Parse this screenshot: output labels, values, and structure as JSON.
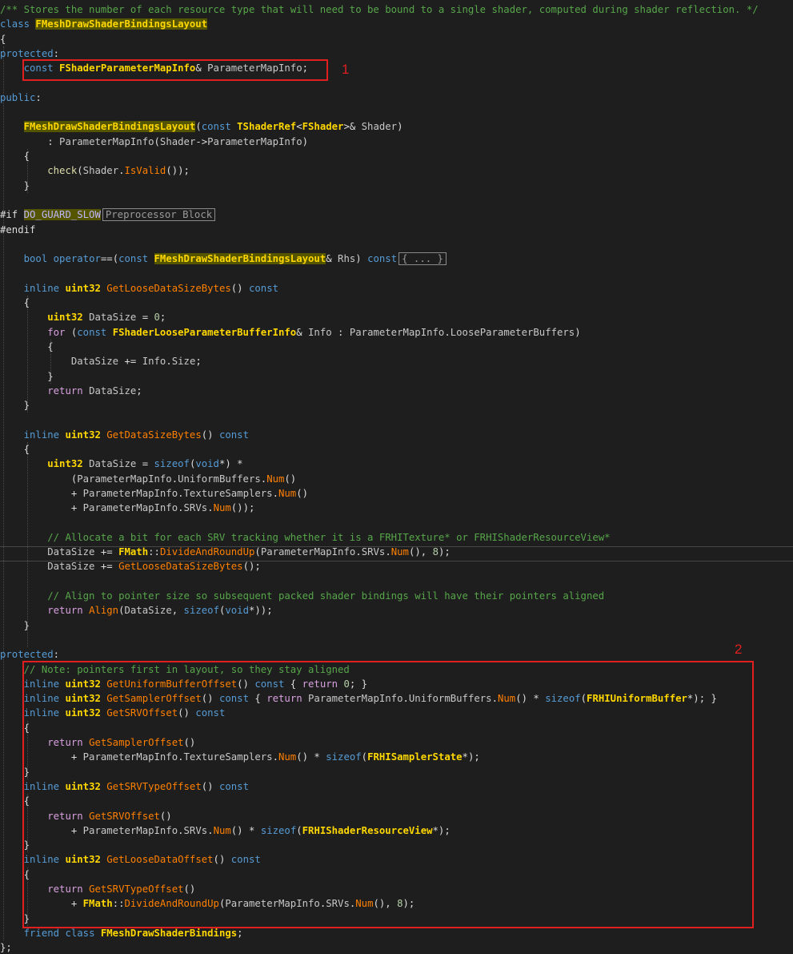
{
  "colors": {
    "keyword": "#569cd6",
    "control": "#d8a0df",
    "type": "#4ec9b0",
    "class": "#ffd700",
    "function": "#dcdcaa",
    "method": "#ff8000",
    "comment": "#57a64a",
    "ident": "#c8c8c8",
    "plain": "#dcdcdc",
    "number": "#b5cea8",
    "param": "#9cdcfe",
    "macro": "#beb7ff",
    "annotation": "#e02020"
  },
  "annotations": [
    "1",
    "2"
  ],
  "collapsed": {
    "preprocessor": "Preprocessor Block",
    "braces": "{ ... }"
  },
  "lines": [
    [
      [
        "comment",
        "/** Stores the number of each resource type that will need to be bound to a single shader, computed during shader reflection. */"
      ]
    ],
    [
      [
        "keyword",
        "class "
      ],
      [
        "class-hl",
        "FMeshDrawShaderBindingsLayout"
      ]
    ],
    [
      [
        "plain",
        "{"
      ]
    ],
    [
      [
        "keyword",
        "protected"
      ],
      [
        "plain",
        ":"
      ]
    ],
    [
      [
        "plain",
        "    "
      ],
      [
        "keyword",
        "const "
      ],
      [
        "class",
        "FShaderParameterMapInfo"
      ],
      [
        "plain",
        "& "
      ],
      [
        "member",
        "ParameterMapInfo"
      ],
      [
        "plain",
        ";"
      ]
    ],
    [],
    [
      [
        "keyword",
        "public"
      ],
      [
        "plain",
        ":"
      ]
    ],
    [],
    [
      [
        "plain",
        "    "
      ],
      [
        "class-hl",
        "FMeshDrawShaderBindingsLayout"
      ],
      [
        "plain",
        "("
      ],
      [
        "keyword",
        "const "
      ],
      [
        "class",
        "TShaderRef"
      ],
      [
        "plain",
        "<"
      ],
      [
        "class",
        "FShader"
      ],
      [
        "plain",
        ">& "
      ],
      [
        "ident",
        "Shader"
      ],
      [
        "plain",
        ")"
      ]
    ],
    [
      [
        "plain",
        "        : "
      ],
      [
        "member",
        "ParameterMapInfo"
      ],
      [
        "plain",
        "("
      ],
      [
        "ident",
        "Shader"
      ],
      [
        "plain",
        "->"
      ],
      [
        "member",
        "ParameterMapInfo"
      ],
      [
        "plain",
        ")"
      ]
    ],
    [
      [
        "plain",
        "    {"
      ]
    ],
    [
      [
        "plain",
        "        "
      ],
      [
        "function",
        "check"
      ],
      [
        "plain",
        "("
      ],
      [
        "ident",
        "Shader"
      ],
      [
        "plain",
        "."
      ],
      [
        "method",
        "IsValid"
      ],
      [
        "plain",
        "());"
      ]
    ],
    [
      [
        "plain",
        "    }"
      ]
    ],
    [],
    [
      [
        "plain",
        "#if "
      ],
      [
        "macro-hl",
        "DO_GUARD_SLOW"
      ],
      [
        "tip",
        "Preprocessor Block"
      ]
    ],
    [
      [
        "plain",
        "#endif"
      ]
    ],
    [],
    [
      [
        "plain",
        "    "
      ],
      [
        "keyword",
        "bool "
      ],
      [
        "keyword",
        "operator"
      ],
      [
        "plain",
        "==("
      ],
      [
        "keyword",
        "const "
      ],
      [
        "class-hl",
        "FMeshDrawShaderBindingsLayout"
      ],
      [
        "plain",
        "& "
      ],
      [
        "ident",
        "Rhs"
      ],
      [
        "plain",
        ") "
      ],
      [
        "keyword",
        "const"
      ],
      [
        "tip2",
        "{ ... }"
      ]
    ],
    [],
    [
      [
        "plain",
        "    "
      ],
      [
        "keyword",
        "inline "
      ],
      [
        "class",
        "uint32 "
      ],
      [
        "method",
        "GetLooseDataSizeBytes"
      ],
      [
        "plain",
        "() "
      ],
      [
        "keyword",
        "const"
      ]
    ],
    [
      [
        "plain",
        "    {"
      ]
    ],
    [
      [
        "plain",
        "        "
      ],
      [
        "class",
        "uint32 "
      ],
      [
        "ident",
        "DataSize"
      ],
      [
        "plain",
        " = "
      ],
      [
        "number",
        "0"
      ],
      [
        "plain",
        ";"
      ]
    ],
    [
      [
        "plain",
        "        "
      ],
      [
        "control",
        "for "
      ],
      [
        "plain",
        "("
      ],
      [
        "keyword",
        "const "
      ],
      [
        "class",
        "FShaderLooseParameterBufferInfo"
      ],
      [
        "plain",
        "& "
      ],
      [
        "ident",
        "Info"
      ],
      [
        "plain",
        " : "
      ],
      [
        "member",
        "ParameterMapInfo"
      ],
      [
        "plain",
        "."
      ],
      [
        "member",
        "LooseParameterBuffers"
      ],
      [
        "plain",
        ")"
      ]
    ],
    [
      [
        "plain",
        "        {"
      ]
    ],
    [
      [
        "plain",
        "            "
      ],
      [
        "ident",
        "DataSize"
      ],
      [
        "plain",
        " += "
      ],
      [
        "ident",
        "Info"
      ],
      [
        "plain",
        "."
      ],
      [
        "member",
        "Size"
      ],
      [
        "plain",
        ";"
      ]
    ],
    [
      [
        "plain",
        "        }"
      ]
    ],
    [
      [
        "plain",
        "        "
      ],
      [
        "control",
        "return "
      ],
      [
        "ident",
        "DataSize"
      ],
      [
        "plain",
        ";"
      ]
    ],
    [
      [
        "plain",
        "    }"
      ]
    ],
    [],
    [
      [
        "plain",
        "    "
      ],
      [
        "keyword",
        "inline "
      ],
      [
        "class",
        "uint32 "
      ],
      [
        "method",
        "GetDataSizeBytes"
      ],
      [
        "plain",
        "() "
      ],
      [
        "keyword",
        "const"
      ]
    ],
    [
      [
        "plain",
        "    {"
      ]
    ],
    [
      [
        "plain",
        "        "
      ],
      [
        "class",
        "uint32 "
      ],
      [
        "ident",
        "DataSize"
      ],
      [
        "plain",
        " = "
      ],
      [
        "keyword",
        "sizeof"
      ],
      [
        "plain",
        "("
      ],
      [
        "keyword",
        "void"
      ],
      [
        "plain",
        "*) *"
      ]
    ],
    [
      [
        "plain",
        "            ("
      ],
      [
        "member",
        "ParameterMapInfo"
      ],
      [
        "plain",
        "."
      ],
      [
        "member",
        "UniformBuffers"
      ],
      [
        "plain",
        "."
      ],
      [
        "method",
        "Num"
      ],
      [
        "plain",
        "()"
      ]
    ],
    [
      [
        "plain",
        "            + "
      ],
      [
        "member",
        "ParameterMapInfo"
      ],
      [
        "plain",
        "."
      ],
      [
        "member",
        "TextureSamplers"
      ],
      [
        "plain",
        "."
      ],
      [
        "method",
        "Num"
      ],
      [
        "plain",
        "()"
      ]
    ],
    [
      [
        "plain",
        "            + "
      ],
      [
        "member",
        "ParameterMapInfo"
      ],
      [
        "plain",
        "."
      ],
      [
        "member",
        "SRVs"
      ],
      [
        "plain",
        "."
      ],
      [
        "method",
        "Num"
      ],
      [
        "plain",
        "());"
      ]
    ],
    [],
    [
      [
        "plain",
        "        "
      ],
      [
        "comment",
        "// Allocate a bit for each SRV tracking whether it is a FRHITexture* or FRHIShaderResourceView*"
      ]
    ],
    [
      [
        "plain",
        "        "
      ],
      [
        "ident",
        "DataSize"
      ],
      [
        "plain",
        " += "
      ],
      [
        "class",
        "FMath"
      ],
      [
        "plain",
        "::"
      ],
      [
        "method",
        "DivideAndRoundUp"
      ],
      [
        "plain",
        "("
      ],
      [
        "member",
        "ParameterMapInfo"
      ],
      [
        "plain",
        "."
      ],
      [
        "member",
        "SRVs"
      ],
      [
        "plain",
        "."
      ],
      [
        "method",
        "Num"
      ],
      [
        "plain",
        "(), "
      ],
      [
        "number",
        "8"
      ],
      [
        "plain",
        ");"
      ]
    ],
    [
      [
        "plain",
        "        "
      ],
      [
        "ident",
        "DataSize"
      ],
      [
        "plain",
        " += "
      ],
      [
        "method",
        "GetLooseDataSizeBytes"
      ],
      [
        "plain",
        "();"
      ]
    ],
    [],
    [
      [
        "plain",
        "        "
      ],
      [
        "comment",
        "// Align to pointer size so subsequent packed shader bindings will have their pointers aligned"
      ]
    ],
    [
      [
        "plain",
        "        "
      ],
      [
        "control",
        "return "
      ],
      [
        "method",
        "Align"
      ],
      [
        "plain",
        "("
      ],
      [
        "ident",
        "DataSize"
      ],
      [
        "plain",
        ", "
      ],
      [
        "keyword",
        "sizeof"
      ],
      [
        "plain",
        "("
      ],
      [
        "keyword",
        "void"
      ],
      [
        "plain",
        "*));"
      ]
    ],
    [
      [
        "plain",
        "    }"
      ]
    ],
    [],
    [
      [
        "keyword",
        "protected"
      ],
      [
        "plain",
        ":"
      ]
    ],
    [
      [
        "plain",
        "    "
      ],
      [
        "comment",
        "// Note: pointers first in layout, so they stay aligned"
      ]
    ],
    [
      [
        "plain",
        "    "
      ],
      [
        "keyword",
        "inline "
      ],
      [
        "class",
        "uint32 "
      ],
      [
        "method",
        "GetUniformBufferOffset"
      ],
      [
        "plain",
        "() "
      ],
      [
        "keyword",
        "const "
      ],
      [
        "plain",
        "{ "
      ],
      [
        "control",
        "return "
      ],
      [
        "number",
        "0"
      ],
      [
        "plain",
        "; }"
      ]
    ],
    [
      [
        "plain",
        "    "
      ],
      [
        "keyword",
        "inline "
      ],
      [
        "class",
        "uint32 "
      ],
      [
        "method",
        "GetSamplerOffset"
      ],
      [
        "plain",
        "() "
      ],
      [
        "keyword",
        "const "
      ],
      [
        "plain",
        "{ "
      ],
      [
        "control",
        "return "
      ],
      [
        "member",
        "ParameterMapInfo"
      ],
      [
        "plain",
        "."
      ],
      [
        "member",
        "UniformBuffers"
      ],
      [
        "plain",
        "."
      ],
      [
        "method",
        "Num"
      ],
      [
        "plain",
        "() * "
      ],
      [
        "keyword",
        "sizeof"
      ],
      [
        "plain",
        "("
      ],
      [
        "class",
        "FRHIUniformBuffer"
      ],
      [
        "plain",
        "*); }"
      ]
    ],
    [
      [
        "plain",
        "    "
      ],
      [
        "keyword",
        "inline "
      ],
      [
        "class",
        "uint32 "
      ],
      [
        "method",
        "GetSRVOffset"
      ],
      [
        "plain",
        "() "
      ],
      [
        "keyword",
        "const"
      ]
    ],
    [
      [
        "plain",
        "    {"
      ]
    ],
    [
      [
        "plain",
        "        "
      ],
      [
        "control",
        "return "
      ],
      [
        "method",
        "GetSamplerOffset"
      ],
      [
        "plain",
        "()"
      ]
    ],
    [
      [
        "plain",
        "            + "
      ],
      [
        "member",
        "ParameterMapInfo"
      ],
      [
        "plain",
        "."
      ],
      [
        "member",
        "TextureSamplers"
      ],
      [
        "plain",
        "."
      ],
      [
        "method",
        "Num"
      ],
      [
        "plain",
        "() * "
      ],
      [
        "keyword",
        "sizeof"
      ],
      [
        "plain",
        "("
      ],
      [
        "class",
        "FRHISamplerState"
      ],
      [
        "plain",
        "*);"
      ]
    ],
    [
      [
        "plain",
        "    }"
      ]
    ],
    [
      [
        "plain",
        "    "
      ],
      [
        "keyword",
        "inline "
      ],
      [
        "class",
        "uint32 "
      ],
      [
        "method",
        "GetSRVTypeOffset"
      ],
      [
        "plain",
        "() "
      ],
      [
        "keyword",
        "const"
      ]
    ],
    [
      [
        "plain",
        "    {"
      ]
    ],
    [
      [
        "plain",
        "        "
      ],
      [
        "control",
        "return "
      ],
      [
        "method",
        "GetSRVOffset"
      ],
      [
        "plain",
        "()"
      ]
    ],
    [
      [
        "plain",
        "            + "
      ],
      [
        "member",
        "ParameterMapInfo"
      ],
      [
        "plain",
        "."
      ],
      [
        "member",
        "SRVs"
      ],
      [
        "plain",
        "."
      ],
      [
        "method",
        "Num"
      ],
      [
        "plain",
        "() * "
      ],
      [
        "keyword",
        "sizeof"
      ],
      [
        "plain",
        "("
      ],
      [
        "class",
        "FRHIShaderResourceView"
      ],
      [
        "plain",
        "*);"
      ]
    ],
    [
      [
        "plain",
        "    }"
      ]
    ],
    [
      [
        "plain",
        "    "
      ],
      [
        "keyword",
        "inline "
      ],
      [
        "class",
        "uint32 "
      ],
      [
        "method",
        "GetLooseDataOffset"
      ],
      [
        "plain",
        "() "
      ],
      [
        "keyword",
        "const"
      ]
    ],
    [
      [
        "plain",
        "    {"
      ]
    ],
    [
      [
        "plain",
        "        "
      ],
      [
        "control",
        "return "
      ],
      [
        "method",
        "GetSRVTypeOffset"
      ],
      [
        "plain",
        "()"
      ]
    ],
    [
      [
        "plain",
        "            + "
      ],
      [
        "class",
        "FMath"
      ],
      [
        "plain",
        "::"
      ],
      [
        "method",
        "DivideAndRoundUp"
      ],
      [
        "plain",
        "("
      ],
      [
        "member",
        "ParameterMapInfo"
      ],
      [
        "plain",
        "."
      ],
      [
        "member",
        "SRVs"
      ],
      [
        "plain",
        "."
      ],
      [
        "method",
        "Num"
      ],
      [
        "plain",
        "(), "
      ],
      [
        "number",
        "8"
      ],
      [
        "plain",
        ");"
      ]
    ],
    [
      [
        "plain",
        "    }"
      ]
    ],
    [
      [
        "plain",
        "    "
      ],
      [
        "keyword",
        "friend "
      ],
      [
        "keyword",
        "class "
      ],
      [
        "class",
        "FMeshDrawShaderBindings"
      ],
      [
        "plain",
        ";"
      ]
    ],
    [
      [
        "plain",
        "};"
      ]
    ]
  ]
}
